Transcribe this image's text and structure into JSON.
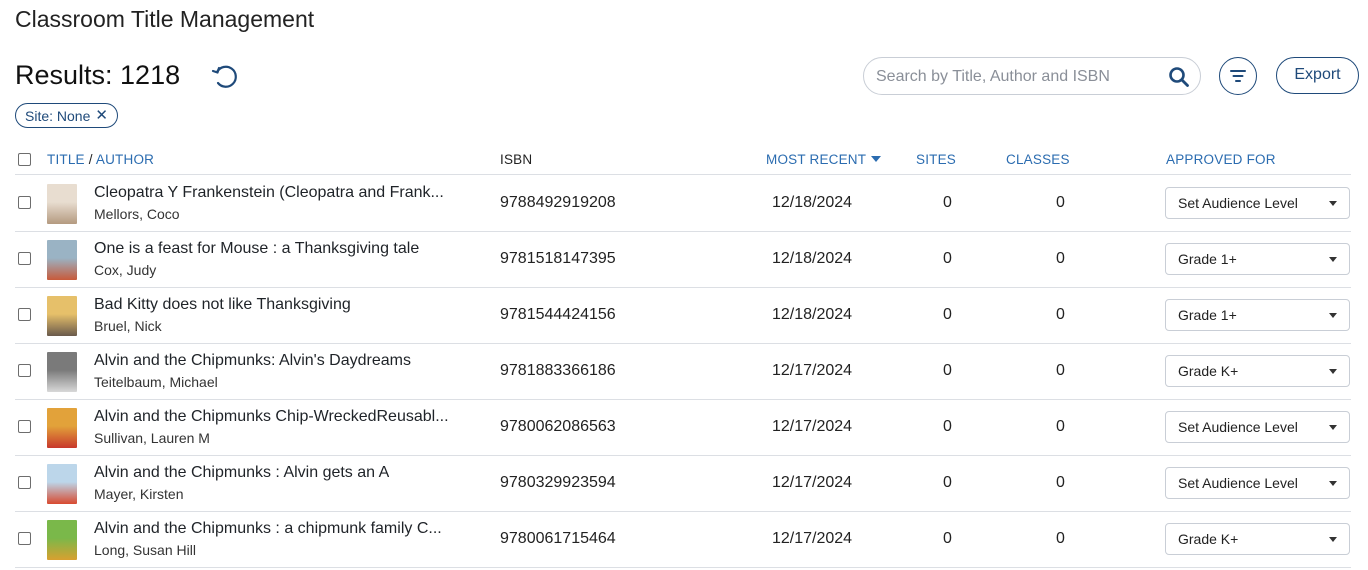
{
  "page_title": "Classroom Title Management",
  "results_label": "Results: 1218",
  "search": {
    "placeholder": "Search by Title, Author and ISBN",
    "value": ""
  },
  "export_label": "Export",
  "filter_chip": {
    "label": "Site: None",
    "remove": "✕"
  },
  "columns": {
    "title": "TITLE",
    "separator": "/",
    "author": "AUTHOR",
    "isbn": "ISBN",
    "most_recent": "MOST RECENT",
    "sites": "SITES",
    "classes": "CLASSES",
    "approved_for": "APPROVED FOR"
  },
  "colors": {
    "accent": "#1f4a7a",
    "header_link": "#2b6cb0",
    "divider": "#dcdfe4"
  },
  "rows": [
    {
      "title": "Cleopatra Y Frankenstein (Cleopatra and Frank...",
      "author": "Mellors, Coco",
      "isbn": "9788492919208",
      "date": "12/18/2024",
      "sites": "0",
      "classes": "0",
      "approved": "Set Audience Level",
      "cover": [
        "#e8ddd0",
        "#b49a80"
      ]
    },
    {
      "title": "One is a feast for Mouse : a Thanksgiving tale",
      "author": "Cox, Judy",
      "isbn": "9781518147395",
      "date": "12/18/2024",
      "sites": "0",
      "classes": "0",
      "approved": "Grade 1+",
      "cover": [
        "#9ab3c4",
        "#c85a3a"
      ]
    },
    {
      "title": "Bad Kitty does not like Thanksgiving",
      "author": "Bruel, Nick",
      "isbn": "9781544424156",
      "date": "12/18/2024",
      "sites": "0",
      "classes": "0",
      "approved": "Grade 1+",
      "cover": [
        "#e6c06a",
        "#6a5a4c"
      ]
    },
    {
      "title": "Alvin and the Chipmunks: Alvin's Daydreams",
      "author": "Teitelbaum, Michael",
      "isbn": "9781883366186",
      "date": "12/17/2024",
      "sites": "0",
      "classes": "0",
      "approved": "Grade K+",
      "cover": [
        "#7a7a7a",
        "#d8d8d8"
      ]
    },
    {
      "title": "Alvin and the Chipmunks Chip-WreckedReusabl...",
      "author": "Sullivan, Lauren M",
      "isbn": "9780062086563",
      "date": "12/17/2024",
      "sites": "0",
      "classes": "0",
      "approved": "Set Audience Level",
      "cover": [
        "#e2a23a",
        "#c8382c"
      ]
    },
    {
      "title": "Alvin and the Chipmunks : Alvin gets an A",
      "author": "Mayer, Kirsten",
      "isbn": "9780329923594",
      "date": "12/17/2024",
      "sites": "0",
      "classes": "0",
      "approved": "Set Audience Level",
      "cover": [
        "#bcd6ea",
        "#d84a30"
      ]
    },
    {
      "title": "Alvin and the Chipmunks : a chipmunk family C...",
      "author": "Long, Susan Hill",
      "isbn": "9780061715464",
      "date": "12/17/2024",
      "sites": "0",
      "classes": "0",
      "approved": "Grade K+",
      "cover": [
        "#7ab84a",
        "#d8a030"
      ]
    }
  ]
}
